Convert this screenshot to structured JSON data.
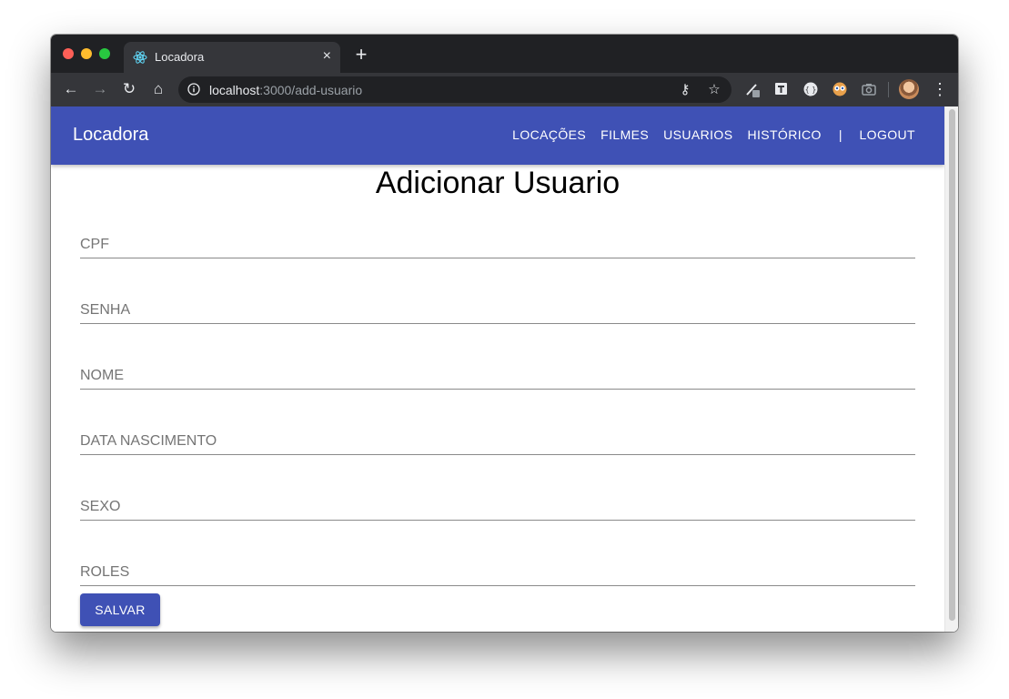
{
  "browser": {
    "tab_title": "Locadora",
    "tab_close": "×",
    "new_tab": "+",
    "url_host": "localhost",
    "url_rest": ":3000/add-usuario",
    "back": "←",
    "forward": "→",
    "reload": "↻",
    "home": "⌂",
    "star": "☆",
    "key": "⚷",
    "menu": "⋮"
  },
  "app": {
    "brand": "Locadora",
    "nav": [
      "LOCAÇÕES",
      "FILMES",
      "USUARIOS",
      "HISTÓRICO"
    ],
    "separator": "|",
    "logout": "LOGOUT",
    "accent_color": "#3f51b5"
  },
  "form": {
    "title": "Adicionar Usuario",
    "fields": [
      {
        "placeholder": "CPF",
        "value": ""
      },
      {
        "placeholder": "SENHA",
        "value": ""
      },
      {
        "placeholder": "NOME",
        "value": ""
      },
      {
        "placeholder": "DATA NASCIMENTO",
        "value": ""
      },
      {
        "placeholder": "SEXO",
        "value": ""
      },
      {
        "placeholder": "ROLES",
        "value": ""
      }
    ],
    "submit": "SALVAR"
  }
}
